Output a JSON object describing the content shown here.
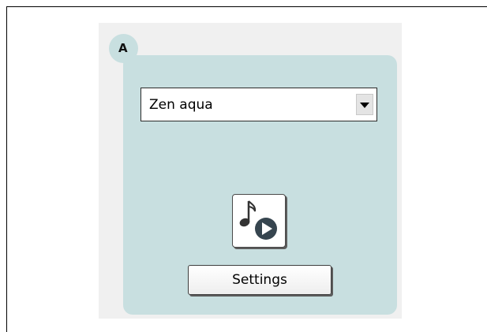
{
  "group": {
    "tab_label": "A",
    "panel_color": "#c8dfe0"
  },
  "theme_select": {
    "selected_value": "Zen aqua",
    "dropdown_icon": "chevron-down-icon"
  },
  "play_button": {
    "icon": "music-note-play-icon"
  },
  "settings_button": {
    "label": "Settings"
  }
}
